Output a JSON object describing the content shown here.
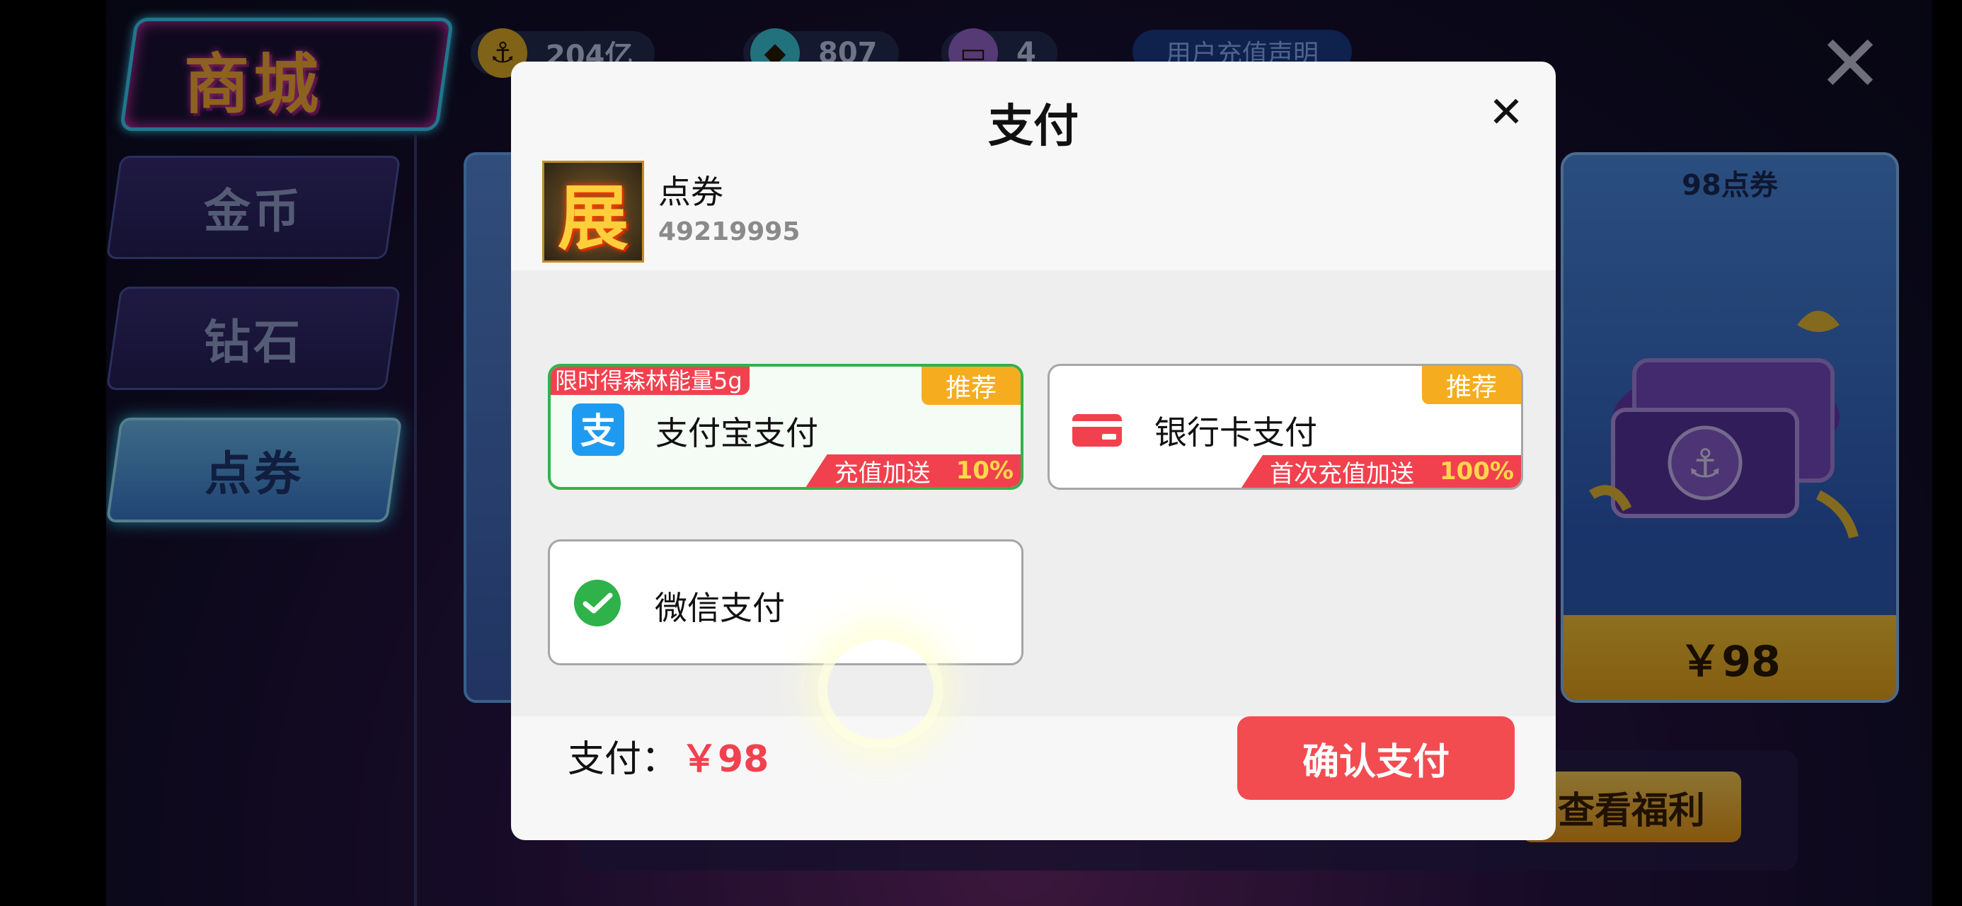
{
  "background": {
    "shop_title": "商城",
    "currencies": [
      {
        "icon": "anchor-coin-icon",
        "value": "204亿"
      },
      {
        "icon": "diamond-icon",
        "value": "807"
      },
      {
        "icon": "ticket-icon",
        "value": "4"
      }
    ],
    "recharge_notice": "用户充值声明",
    "tabs": [
      {
        "label": "金币"
      },
      {
        "label": "钻石"
      },
      {
        "label": "点券"
      }
    ],
    "product_card": {
      "title": "98点券",
      "price": "￥98"
    },
    "welfare_button": "查看福利"
  },
  "modal": {
    "title": "支付",
    "product": {
      "thumb_char": "展",
      "name": "点券",
      "id": "49219995"
    },
    "payment_methods": [
      {
        "label": "支付宝支付",
        "icon": "alipay-icon",
        "recommend": "推荐",
        "bonus_text": "充值加送",
        "bonus_pct": "10%",
        "limited": "限时得森林能量5g",
        "selected": true
      },
      {
        "label": "银行卡支付",
        "icon": "bank-card-icon",
        "recommend": "推荐",
        "bonus_text": "首次充值加送",
        "bonus_pct": "100%"
      },
      {
        "label": "微信支付",
        "icon": "wechat-icon"
      }
    ],
    "total_label": "支付：",
    "total_value": "￥98",
    "confirm_label": "确认支付"
  },
  "colors": {
    "accent": "#f24c51",
    "recommend": "#f5ad1f",
    "selected_border": "#31b24b"
  }
}
